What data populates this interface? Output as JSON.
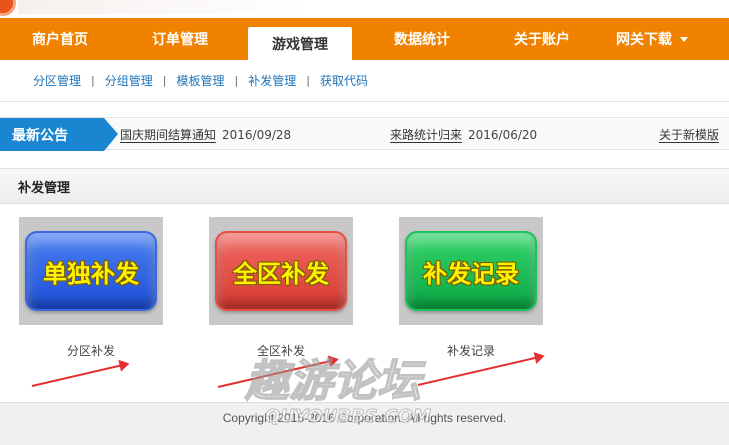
{
  "nav": {
    "items": [
      {
        "label": "商户首页"
      },
      {
        "label": "订单管理"
      },
      {
        "label": "游戏管理",
        "active": true
      },
      {
        "label": "数据统计"
      },
      {
        "label": "关于账户"
      },
      {
        "label": "网关下载",
        "has_dropdown": true
      }
    ]
  },
  "subnav": {
    "items": [
      {
        "label": "分区管理"
      },
      {
        "label": "分组管理"
      },
      {
        "label": "模板管理"
      },
      {
        "label": "补发管理"
      },
      {
        "label": "获取代码"
      }
    ],
    "separator": "|"
  },
  "notice": {
    "tag": "最新公告",
    "items": [
      {
        "title": "国庆期间结算通知",
        "date": "2016/09/28"
      },
      {
        "title": "来路统计归来",
        "date": "2016/06/20"
      },
      {
        "title": "关于新模版",
        "date": ""
      }
    ]
  },
  "section": {
    "title": "补发管理"
  },
  "cards": [
    {
      "button_text": "单独补发",
      "caption": "分区补发",
      "color": "#2a5fe0"
    },
    {
      "button_text": "全区补发",
      "caption": "全区补发",
      "color": "#e2463c"
    },
    {
      "button_text": "补发记录",
      "caption": "补发记录",
      "color": "#12bb52"
    }
  ],
  "footer": {
    "text": "Copyright 2015-2016 Corporation. All rights reserved."
  },
  "watermark": {
    "text": "趣游论坛",
    "subtext": "QUYOUBBS.COM"
  },
  "colors": {
    "nav_bg": "#f08200",
    "link": "#1d73b8",
    "notice_tag": "#1a86d1",
    "arrow": "#e53030"
  }
}
